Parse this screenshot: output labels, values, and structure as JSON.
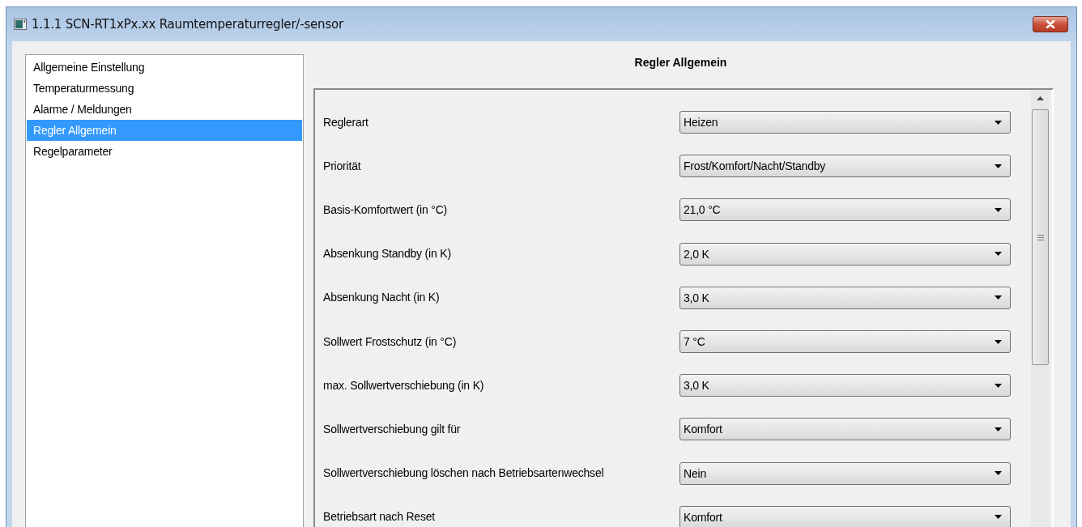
{
  "window": {
    "title": "1.1.1 SCN-RT1xPx.xx Raumtemperaturregler/-sensor"
  },
  "sidebar": {
    "items": [
      {
        "label": "Allgemeine Einstellung",
        "selected": false
      },
      {
        "label": "Temperaturmessung",
        "selected": false
      },
      {
        "label": "Alarme / Meldungen",
        "selected": false
      },
      {
        "label": "Regler Allgemein",
        "selected": true
      },
      {
        "label": "Regelparameter",
        "selected": false
      }
    ]
  },
  "panel": {
    "title": "Regler Allgemein",
    "parameters": [
      {
        "label": "Reglerart",
        "value": "Heizen"
      },
      {
        "label": "Priorität",
        "value": "Frost/Komfort/Nacht/Standby"
      },
      {
        "label": "Basis-Komfortwert (in °C)",
        "value": "21,0 °C"
      },
      {
        "label": "Absenkung Standby (in K)",
        "value": "2,0 K"
      },
      {
        "label": "Absenkung Nacht (in K)",
        "value": "3,0 K"
      },
      {
        "label": "Sollwert Frostschutz (in °C)",
        "value": "7 °C"
      },
      {
        "label": "max. Sollwertverschiebung (in K)",
        "value": "3,0 K"
      },
      {
        "label": "Sollwertverschiebung gilt für",
        "value": "Komfort"
      },
      {
        "label": "Sollwertverschiebung löschen nach Betriebsartenwechsel",
        "value": "Nein"
      },
      {
        "label": "Betriebsart nach Reset",
        "value": "Komfort"
      }
    ]
  }
}
